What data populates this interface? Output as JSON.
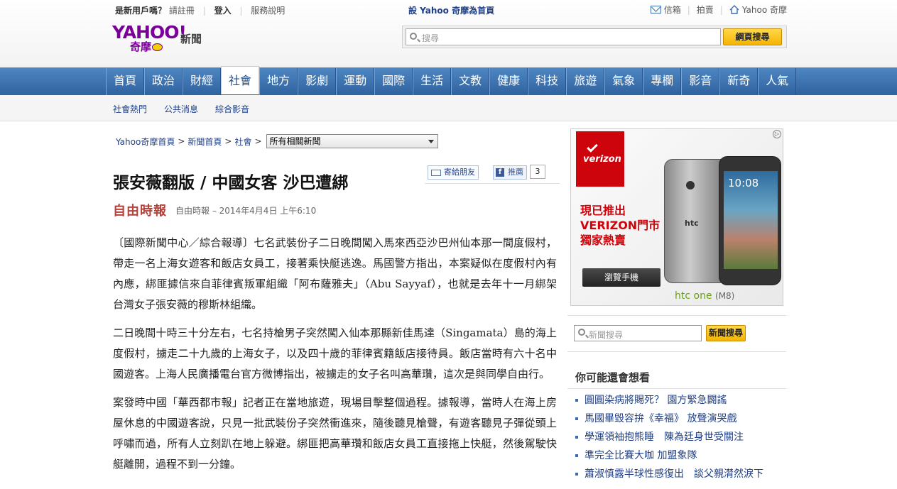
{
  "header": {
    "util_question": "是新用戶嗎？",
    "register": "請註冊",
    "login": "登入",
    "service": "服務說明",
    "set_home": "設 Yahoo 奇摩為首頁",
    "mail": "信箱",
    "auction": "拍賣",
    "yahoo_home": "Yahoo 奇摩",
    "logo_yahoo": "YAHOO!",
    "logo_kimo": "奇摩",
    "logo_news": "新聞",
    "search_placeholder": "搜尋",
    "search_button": "網頁搜尋"
  },
  "nav": {
    "items": [
      "首頁",
      "政治",
      "財經",
      "社會",
      "地方",
      "影劇",
      "運動",
      "國際",
      "生活",
      "文教",
      "健康",
      "科技",
      "旅遊",
      "氣象",
      "專欄",
      "影音",
      "新奇",
      "人氣"
    ],
    "active": "社會"
  },
  "subnav": [
    "社會熱門",
    "公共消息",
    "綜合影音"
  ],
  "breadcrumb": {
    "items": [
      "Yahoo奇摩首頁",
      "新聞首頁",
      "社會"
    ],
    "select": "所有相關新聞"
  },
  "article": {
    "title": "張安薇翻版 / 中國女客 沙巴遭綁",
    "source_brand": "自由時報",
    "meta": "自由時報 – 2014年4月4日 上午6:10",
    "share_mail": "寄給朋友",
    "share_fb": "推薦",
    "share_count": "3",
    "paragraphs": [
      "〔國際新聞中心／綜合報導〕七名武裝份子二日晚間闖入馬來西亞沙巴州仙本那一間度假村，帶走一名上海女遊客和飯店女員工，接著乘快艇逃逸。馬國警方指出，本案疑似在度假村內有內應，綁匪據信來自菲律賓叛軍組織「阿布薩雅夫」（Abu Sayyaf），也就是去年十一月綁架台灣女子張安薇的穆斯林組織。",
      "二日晚間十時三十分左右，七名持槍男子突然闖入仙本那縣新佳馬達（Singamata）島的海上度假村，擄走二十九歲的上海女子，以及四十歲的菲律賓籍飯店接待員。飯店當時有六十名中國遊客。上海人民廣播電台官方微博指出，被擄走的女子名叫高華瓚，這次是與同學自由行。",
      "案發時中國「華西都市報」記者正在當地旅遊，現場目擊整個過程。據報導，當時人在海上房屋休息的中國遊客說，只見一批武裝份子突然衝進來，隨後聽見槍聲，有遊客聽見子彈從頭上呼嘯而過，所有人立刻趴在地上躲避。綁匪把高華瓚和飯店女員工直接拖上快艇，然後駕駛快艇離開，過程不到一分鐘。"
    ]
  },
  "ad": {
    "brand": "verizon",
    "line1": "現已推出",
    "line2": "VERIZON門市",
    "line3": "獨家熱賣",
    "button": "瀏覽手機",
    "phone_brand": "htc",
    "phone_time": "10:08",
    "tagline": "htc one",
    "tagline_suffix": "(M8)",
    "colors": {
      "verizon_red": "#cd040b",
      "htc_green": "#6aa018"
    }
  },
  "sidebar_search": {
    "placeholder": "新聞搜尋",
    "button": "新聞搜尋"
  },
  "related": {
    "title": "你可能還會想看",
    "items": [
      "圓圓染病將賜死？ 園方緊急闢謠",
      "馬國畢毀容拚《幸福》 放聲演哭戲",
      "學運領袖抱熊睡　陳為廷身世受關注",
      "準完全比賽大咖 加盟象隊",
      "蕭淑慎露半球性感復出　談父親潸然淚下"
    ]
  }
}
